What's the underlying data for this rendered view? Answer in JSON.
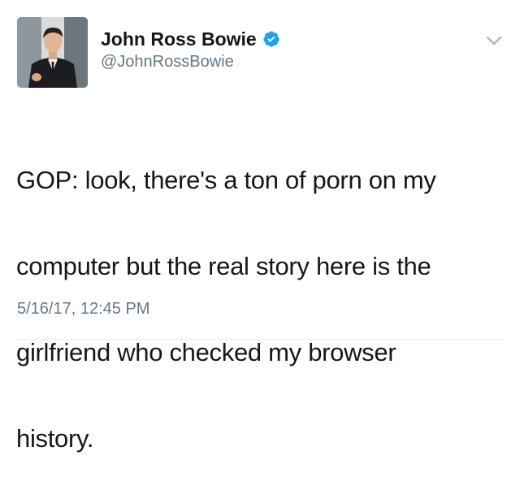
{
  "tweet": {
    "author": {
      "display_name": "John Ross Bowie",
      "handle": "@JohnRossBowie",
      "verified": true,
      "avatar_alt": "profile-photo"
    },
    "text_lines": [
      "GOP: look, there's a ton of porn on my",
      "computer but the real story here is the",
      "girlfriend who checked my browser",
      "history."
    ],
    "timestamp": "5/16/17, 12:45 PM"
  },
  "colors": {
    "text": "#14171a",
    "secondary": "#657786",
    "verified_blue": "#1da1f2",
    "divider": "#e6ecf0"
  },
  "icons": {
    "verified": "verified-badge-icon",
    "menu": "chevron-down-icon"
  }
}
